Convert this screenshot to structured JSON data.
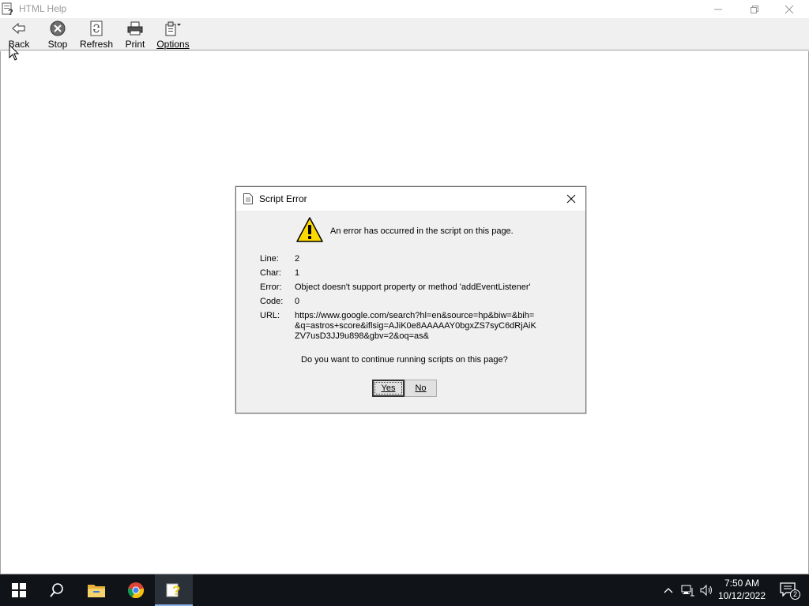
{
  "window": {
    "title": "HTML Help"
  },
  "toolbar": {
    "back": "Back",
    "stop": "Stop",
    "refresh": "Refresh",
    "print": "Print",
    "options": "Options"
  },
  "dialog": {
    "title": "Script Error",
    "message": "An error has occurred in the script on this page.",
    "fields": [
      {
        "key": "Line:",
        "value": "2"
      },
      {
        "key": "Char:",
        "value": "1"
      },
      {
        "key": "Error:",
        "value": "Object doesn't support property or method 'addEventListener'"
      },
      {
        "key": "Code:",
        "value": "0"
      },
      {
        "key": "URL:",
        "value": "https://www.google.com/search?hl=en&source=hp&biw=&bih=&q=astros+score&iflsig=AJiK0e8AAAAAY0bgxZS7syC6dRjAiKZV7usD3JJ9u898&gbv=2&oq=as&"
      }
    ],
    "question": "Do you want to continue running scripts on this page?",
    "yes": "Yes",
    "no": "No"
  },
  "taskbar": {
    "time": "7:50 AM",
    "date": "10/12/2022",
    "notification_count": "2"
  },
  "colors": {
    "taskbar_bg": "#101418",
    "dialog_bg": "#f0f0f0",
    "toolbar_bg": "#f0f0f0",
    "warning_yellow": "#ffd800"
  }
}
